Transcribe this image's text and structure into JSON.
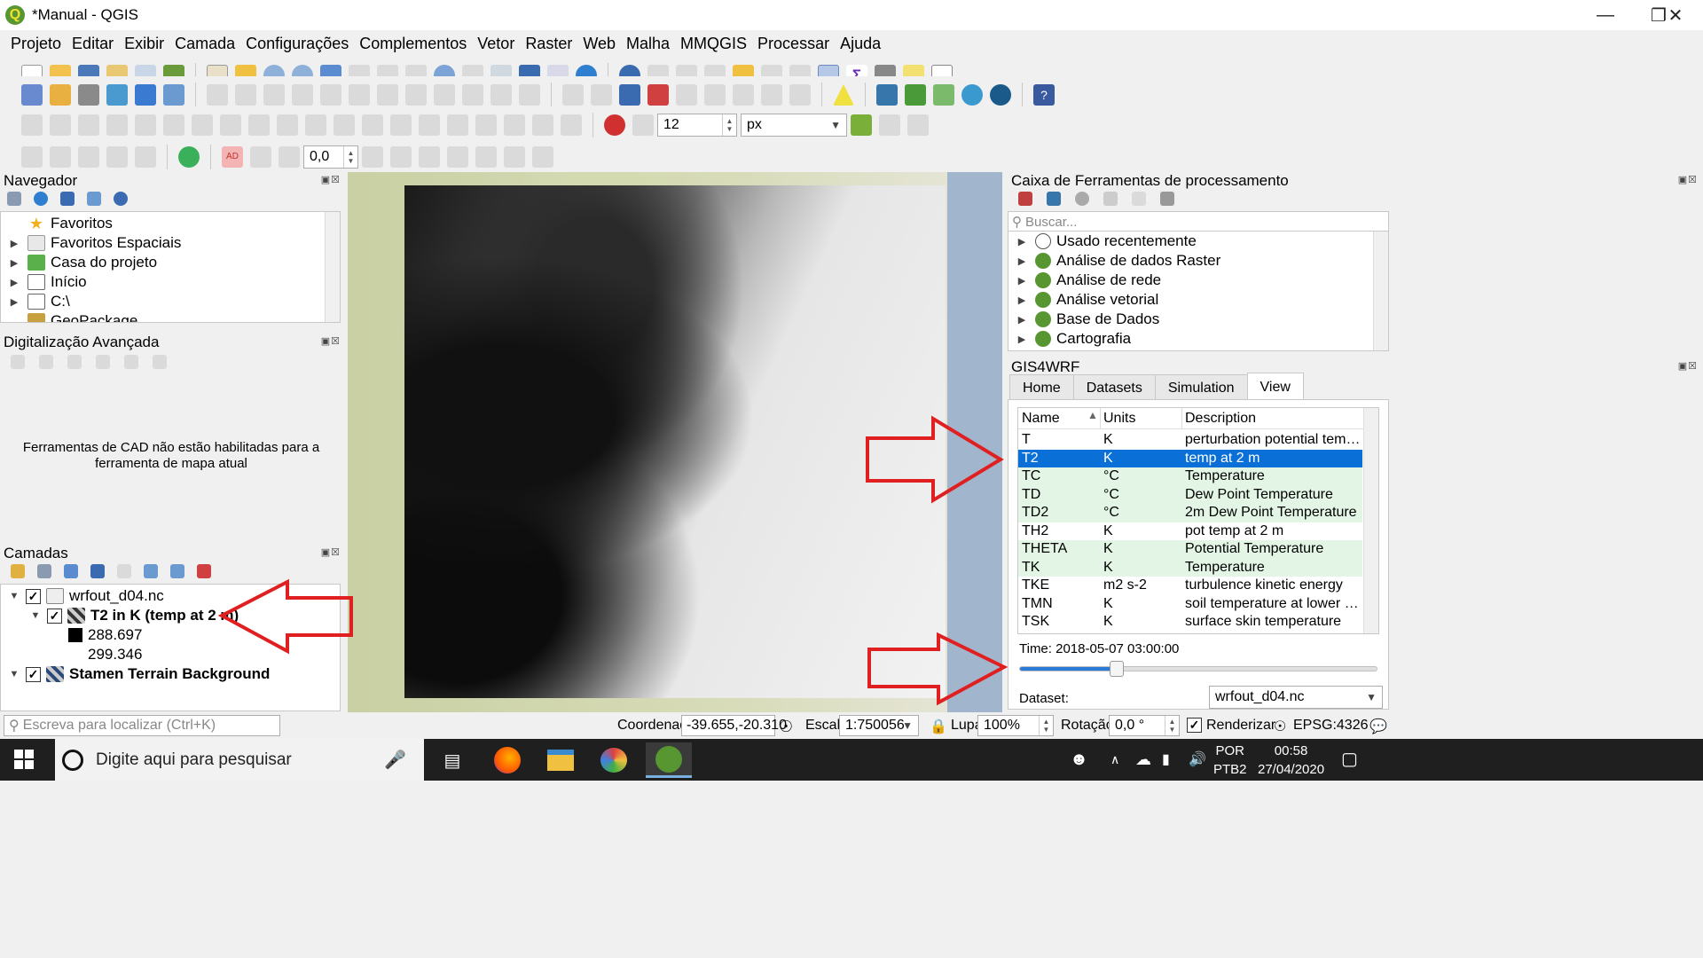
{
  "window": {
    "title": "*Manual - QGIS",
    "logo_letter": "Q"
  },
  "menu": [
    "Projeto",
    "Editar",
    "Exibir",
    "Camada",
    "Configurações",
    "Complementos",
    "Vetor",
    "Raster",
    "Web",
    "Malha",
    "MMQGIS",
    "Processar",
    "Ajuda"
  ],
  "toolbar3": {
    "size_value": "12",
    "unit": "px"
  },
  "toolbar4": {
    "rotation_value": "0,0"
  },
  "navigator": {
    "title": "Navegador",
    "items": [
      "Favoritos",
      "Favoritos Espaciais",
      "Casa do projeto",
      "Início",
      "C:\\",
      "GeoPackage"
    ]
  },
  "advdigit": {
    "title": "Digitalização Avançada",
    "message": "Ferramentas de CAD não estão habilitadas para a ferramenta de mapa atual"
  },
  "layers": {
    "title": "Camadas",
    "group": "wrfout_d04.nc",
    "layer": "T2 in K (temp at 2 m)",
    "legend_min": "288.697",
    "legend_max": "299.346",
    "basemap": "Stamen Terrain Background"
  },
  "processing": {
    "title": "Caixa de Ferramentas de processamento",
    "search_placeholder": "Buscar...",
    "items": [
      "Usado recentemente",
      "Análise de dados Raster",
      "Análise de rede",
      "Análise vetorial",
      "Base de Dados",
      "Cartografia"
    ]
  },
  "gis4wrf": {
    "title": "GIS4WRF",
    "tabs": [
      "Home",
      "Datasets",
      "Simulation",
      "View"
    ],
    "active_tab": "View",
    "columns": [
      "Name",
      "Units",
      "Description"
    ],
    "rows": [
      {
        "name": "T",
        "units": "K",
        "desc": "perturbation potential tempe..."
      },
      {
        "name": "T2",
        "units": "K",
        "desc": "temp at 2 m"
      },
      {
        "name": "TC",
        "units": "°C",
        "desc": "Temperature"
      },
      {
        "name": "TD",
        "units": "°C",
        "desc": "Dew Point Temperature"
      },
      {
        "name": "TD2",
        "units": "°C",
        "desc": "2m Dew Point Temperature"
      },
      {
        "name": "TH2",
        "units": "K",
        "desc": "pot temp at 2 m"
      },
      {
        "name": "THETA",
        "units": "K",
        "desc": "Potential Temperature"
      },
      {
        "name": "TK",
        "units": "K",
        "desc": "Temperature"
      },
      {
        "name": "TKE",
        "units": "m2 s-2",
        "desc": "turbulence kinetic energy"
      },
      {
        "name": "TMN",
        "units": "K",
        "desc": "soil temperature at lower bo..."
      },
      {
        "name": "TSK",
        "units": "K",
        "desc": "surface skin temperature"
      }
    ],
    "selected_row": "T2",
    "time_label": "Time: 2018-05-07 03:00:00",
    "slider_fraction": 0.27,
    "dataset_label": "Dataset:",
    "dataset_value": "wrfout_d04.nc"
  },
  "statusbar": {
    "locator_placeholder": "Escreva para localizar (Ctrl+K)",
    "coord_label": "Coordenada",
    "coord_value": "-39.655,-20.310",
    "scale_label": "Escala",
    "scale_value": "1:750056",
    "magnifier_label": "Lupa",
    "magnifier_value": "100%",
    "rotation_label": "Rotação",
    "rotation_value": "0,0 °",
    "render_label": "Renderizar",
    "crs": "EPSG:4326"
  },
  "taskbar": {
    "search_placeholder": "Digite aqui para pesquisar",
    "lang1": "POR",
    "lang2": "PTB2",
    "time": "00:58",
    "date": "27/04/2020"
  },
  "colors": {
    "selection": "#0a6fd7",
    "highlight_row": "#e3f6e5",
    "arrow": "#e02020"
  }
}
